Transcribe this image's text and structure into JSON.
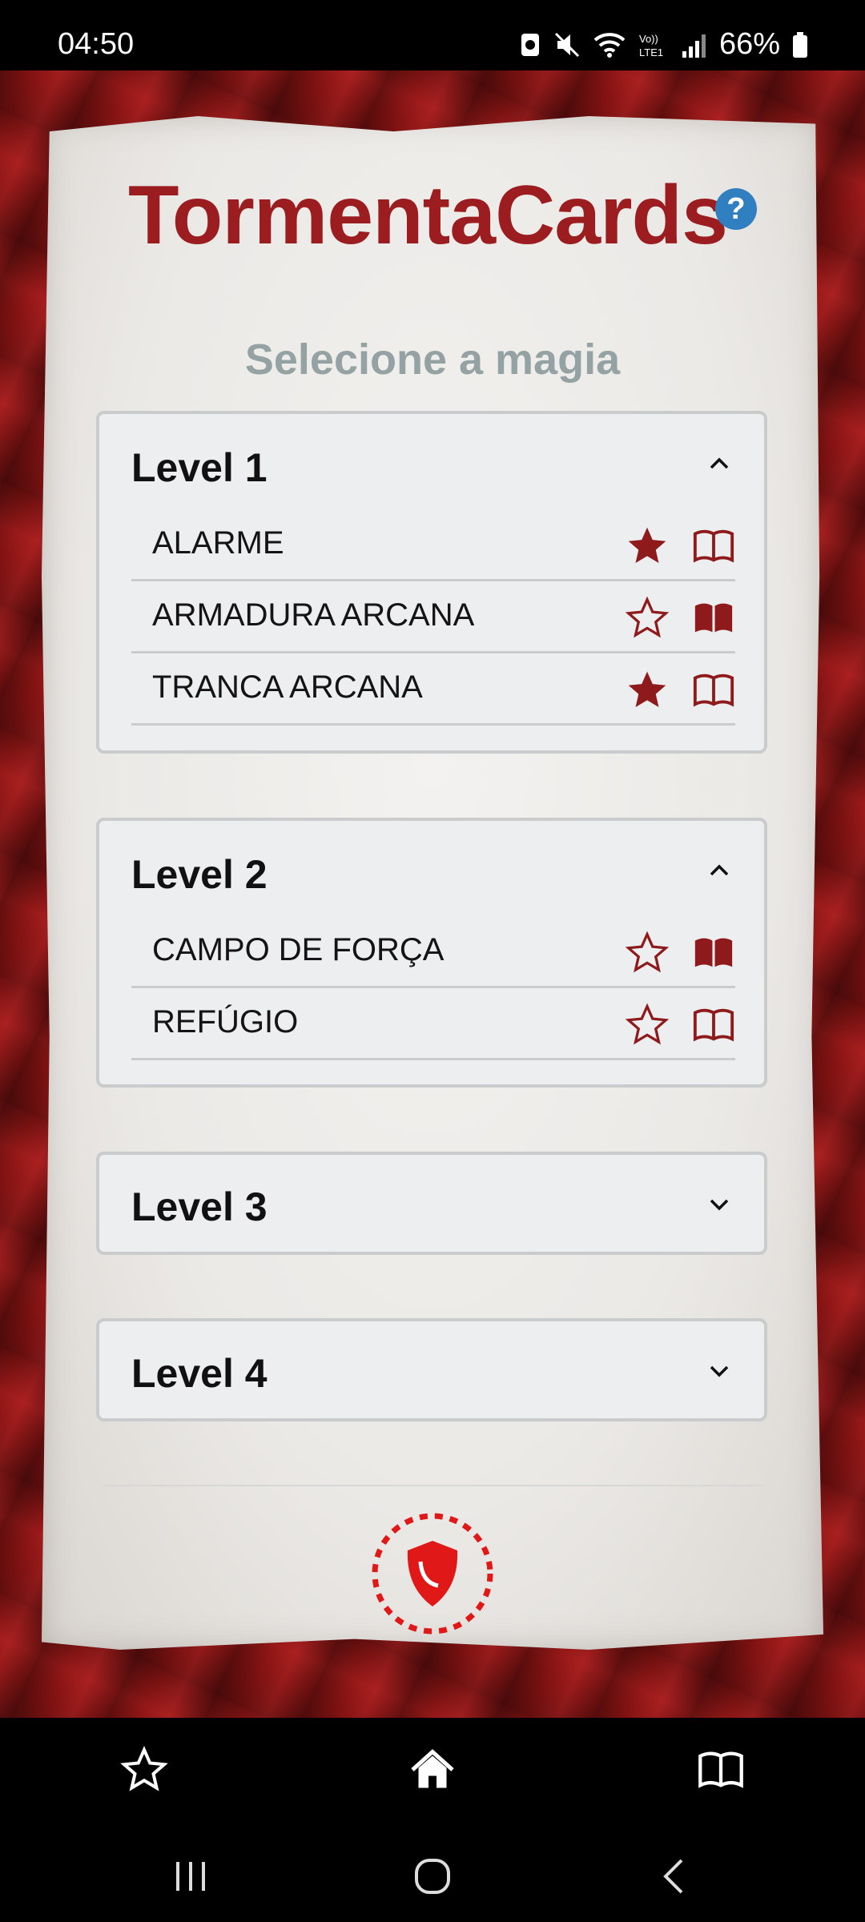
{
  "status_bar": {
    "time": "04:50",
    "battery_percent": "66%",
    "icons": [
      "screenshot-icon",
      "mute-icon",
      "wifi-icon",
      "volte-icon",
      "signal-icon",
      "battery-icon"
    ]
  },
  "header": {
    "app_title": "TormentaCards",
    "help_icon_glyph": "?"
  },
  "subtitle": "Selecione a magia",
  "levels": [
    {
      "title": "Level 1",
      "expanded": true,
      "spells": [
        {
          "name": "ALARME",
          "favorite": true,
          "book_filled": false
        },
        {
          "name": "ARMADURA ARCANA",
          "favorite": false,
          "book_filled": true
        },
        {
          "name": "TRANCA ARCANA",
          "favorite": true,
          "book_filled": false
        }
      ]
    },
    {
      "title": "Level 2",
      "expanded": true,
      "spells": [
        {
          "name": "CAMPO DE FORÇA",
          "favorite": false,
          "book_filled": true
        },
        {
          "name": "REFÚGIO",
          "favorite": false,
          "book_filled": false
        }
      ]
    },
    {
      "title": "Level 3",
      "expanded": false,
      "spells": []
    },
    {
      "title": "Level 4",
      "expanded": false,
      "spells": []
    }
  ],
  "bottom_nav": {
    "items": [
      "favorites-star-icon",
      "home-icon",
      "book-icon"
    ]
  },
  "colors": {
    "accent": "#9b1d20",
    "subtitle": "#95a2a3",
    "help": "#2f7fc1",
    "panel_bg": "#eceeef"
  }
}
